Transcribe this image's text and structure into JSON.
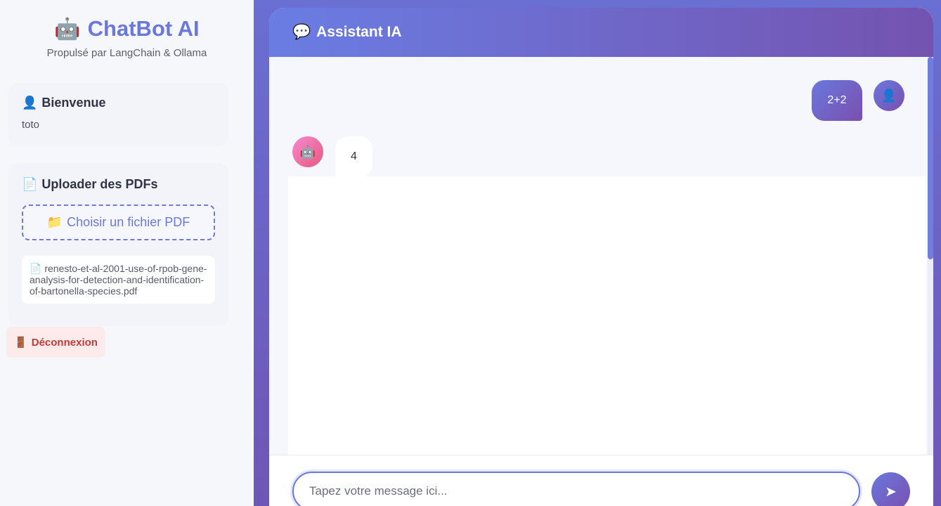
{
  "sidebar": {
    "brand_icon": "🤖",
    "brand_title": "ChatBot AI",
    "brand_subtitle": "Propulsé par LangChain & Ollama",
    "welcome": {
      "icon": "👤",
      "title": "Bienvenue",
      "username": "toto"
    },
    "upload": {
      "icon": "📄",
      "title": "Uploader des PDFs",
      "button_icon": "📁",
      "button_label": "Choisir un fichier PDF",
      "files": [
        {
          "icon": "📄",
          "name": "renesto-et-al-2001-use-of-rpob-gene-analysis-for-detection-and-identification-of-bartonella-species.pdf"
        }
      ]
    },
    "logout": {
      "icon": "🚪",
      "label": "Déconnexion"
    }
  },
  "chat": {
    "header_icon": "💬",
    "header_title": "Assistant IA",
    "messages": [
      {
        "role": "user",
        "avatar": "👤",
        "text": "2+2"
      },
      {
        "role": "bot",
        "avatar": "🤖",
        "text": "4"
      }
    ],
    "input_placeholder": "Tapez votre message ici...",
    "input_value": "",
    "send_icon": "➤"
  },
  "colors": {
    "accent": "#6a78de",
    "accent_dark": "#7453b0",
    "logout_text": "#c23b3b",
    "logout_bg": "#fdeaea"
  }
}
